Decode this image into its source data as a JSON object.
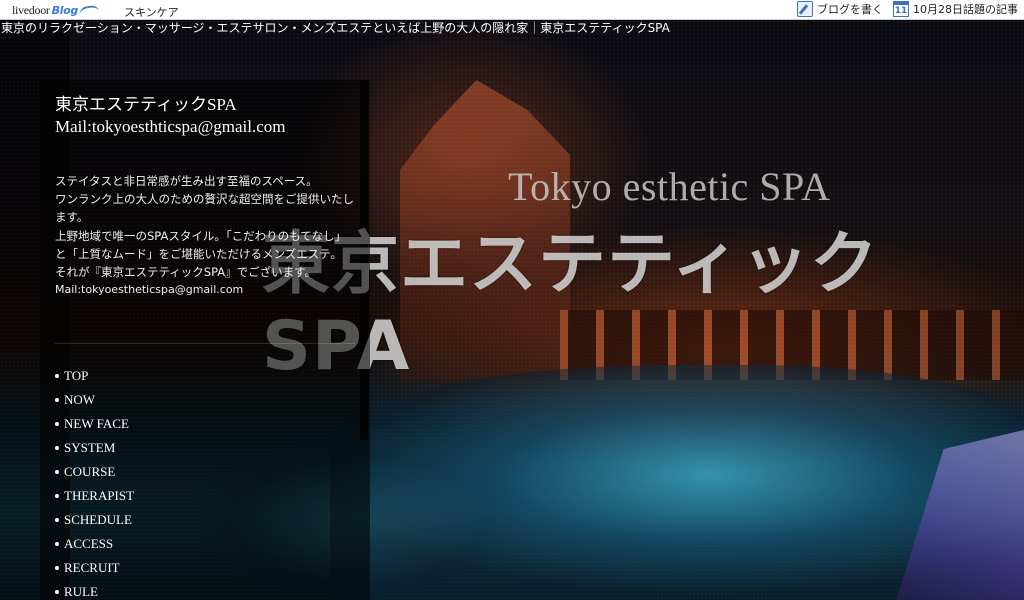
{
  "topbar": {
    "logo_text": "livedoor",
    "logo_blog": "Blog",
    "skincare_link": "スキンケア",
    "write_blog": "ブログを書く",
    "calendar_day": "11",
    "topic_link": "10月28日話題の記事"
  },
  "page": {
    "heading": "東京のリラクゼーション・マッサージ・エステサロン・メンズエステといえば上野の大人の隠れ家｜東京エステティックSPA"
  },
  "hero": {
    "title_en": "Tokyo esthetic SPA",
    "title_jp": "東京エステティックSPA"
  },
  "sidebar": {
    "shop_name": "東京エステティックSPA",
    "shop_mail": "Mail:tokyoesthticspa@gmail.com",
    "description": [
      "ステイタスと非日常感が生み出す至福のスペース。",
      "ワンランク上の大人のための贅沢な超空間をご提供いたします。",
      "上野地域で唯一のSPAスタイル。「こだわりのもてなし」と「上質なムード」をご堪能いただけるメンズエステ。",
      "それが『東京エステティックSPA』でございます。"
    ],
    "mail_small": "Mail:tokyoestheticspa@gmail.com",
    "nav": [
      "TOP",
      "NOW",
      "NEW FACE",
      "SYSTEM",
      "COURSE",
      "THERAPIST",
      "SCHEDULE",
      "ACCESS",
      "RECRUIT",
      "RULE"
    ]
  }
}
